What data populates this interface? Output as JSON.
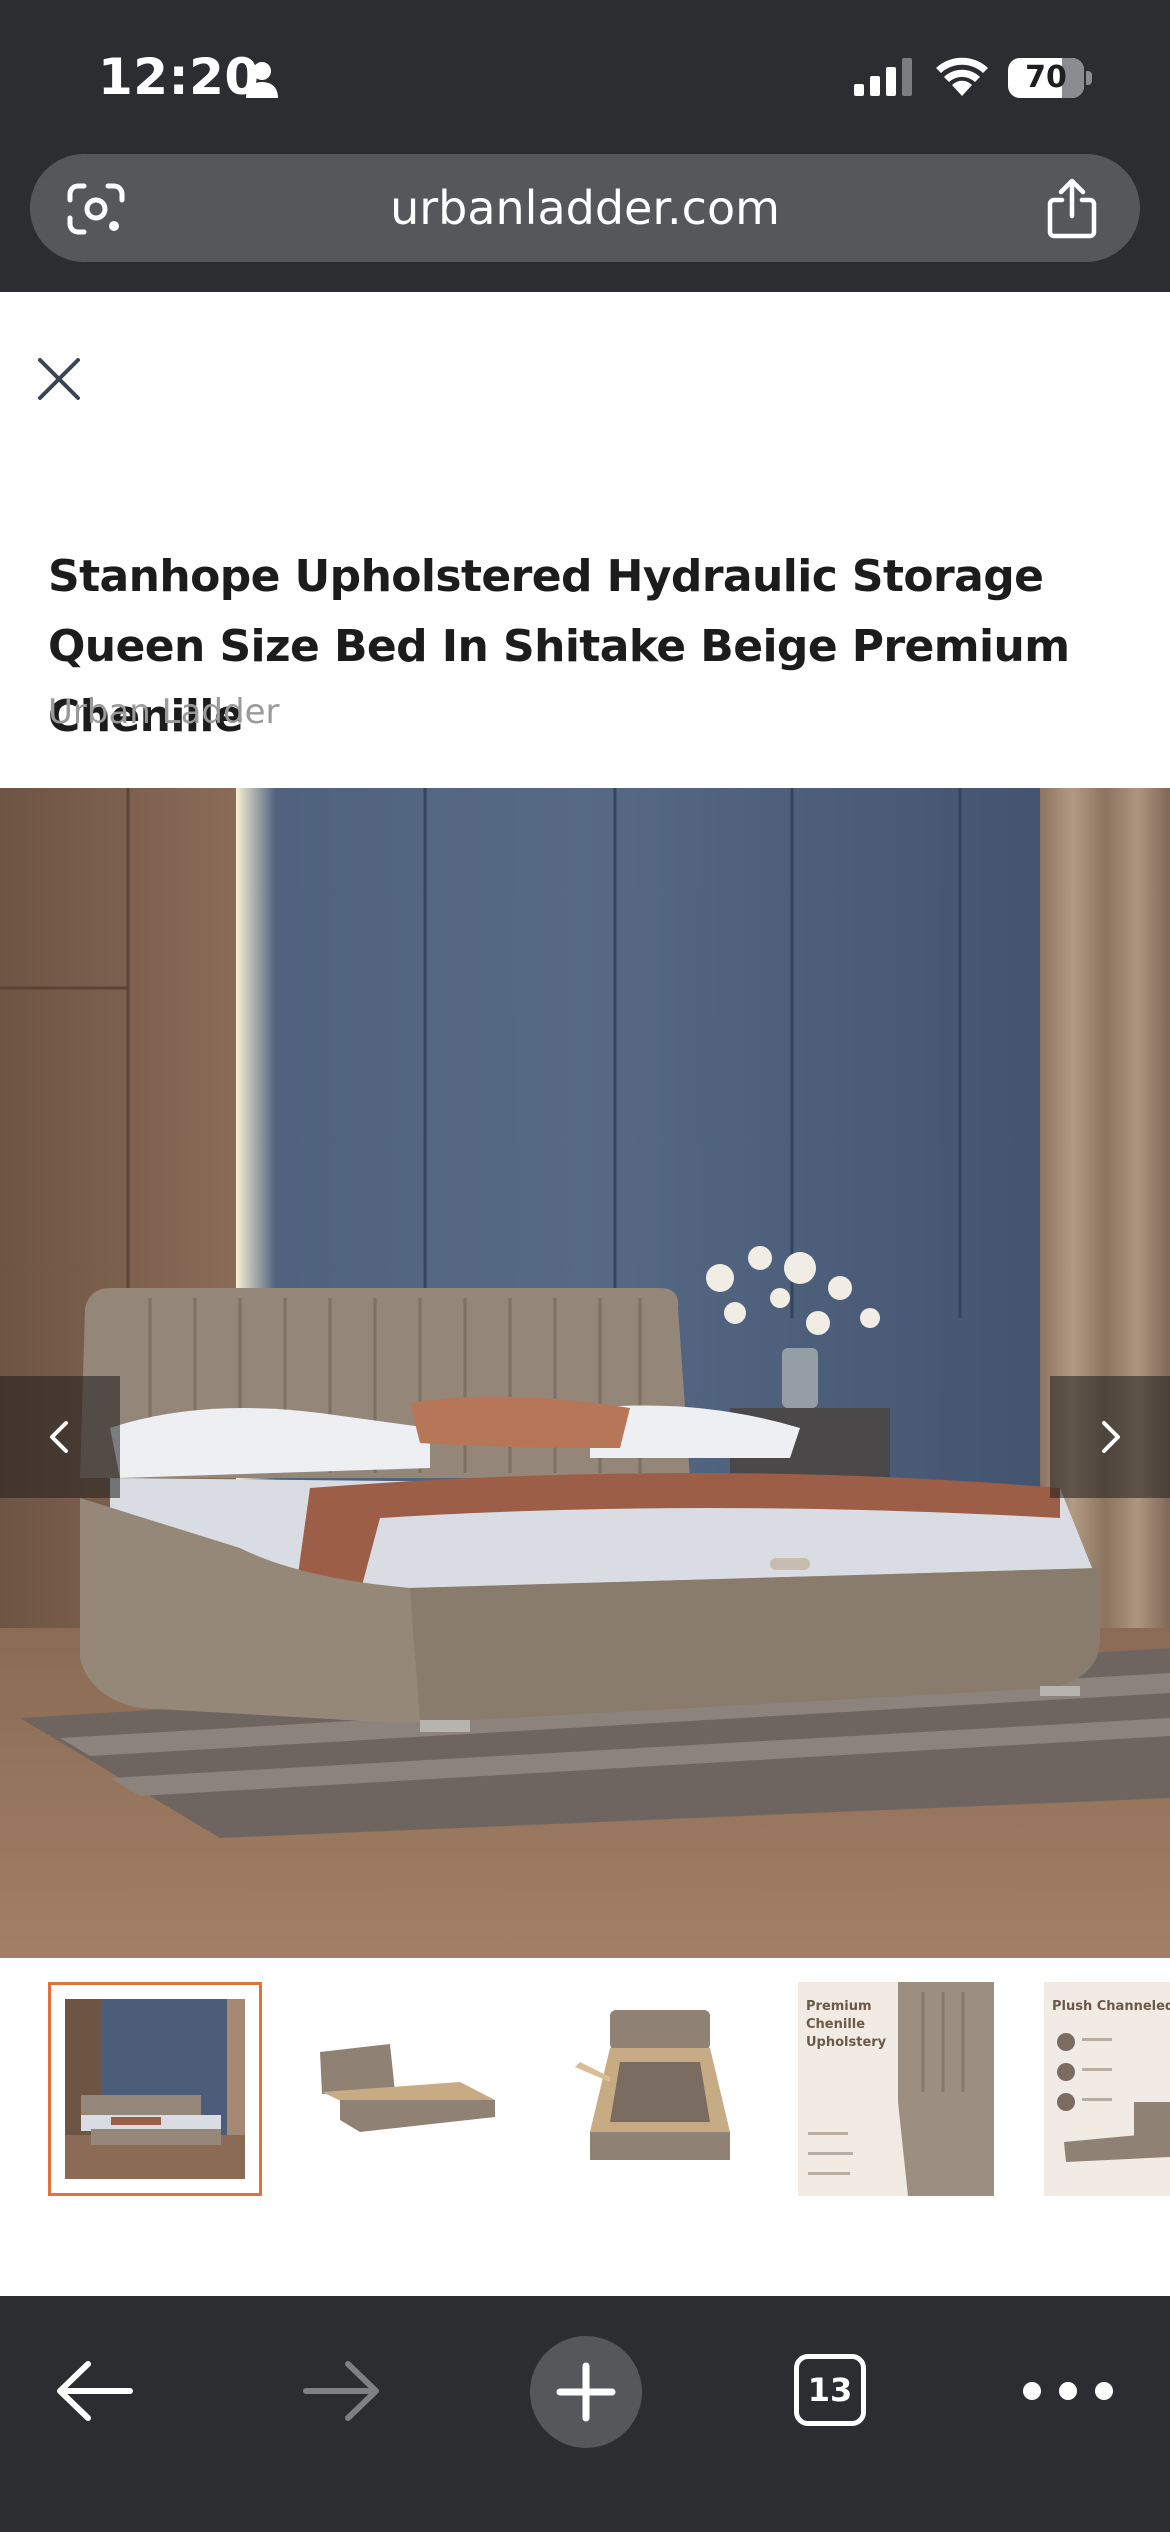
{
  "status_bar": {
    "time": "12:20",
    "battery": "70"
  },
  "browser": {
    "url": "urbanladder.com",
    "tab_count": "13"
  },
  "product": {
    "title": "Stanhope Upholstered Hydraulic Storage Queen Size Bed In Shitake Beige Premium Chenille",
    "brand": "Urban Ladder"
  },
  "gallery": {
    "selected_index": 0,
    "thumbnails": [
      {
        "alt": "bed-in-room-thumbnail"
      },
      {
        "alt": "bed-side-view-thumbnail"
      },
      {
        "alt": "bed-storage-open-thumbnail"
      },
      {
        "alt": "premium-chenille-upholstery-thumbnail",
        "text_lines": [
          "Premium",
          "Chenille",
          "Upholstery"
        ]
      },
      {
        "alt": "plush-channeled-headboard-thumbnail",
        "text_lines": [
          "Plush Channeled Headbo"
        ]
      }
    ]
  },
  "colors": {
    "chrome_bg": "#2c2d30",
    "pill_bg": "#55575b",
    "accent": "#e0733b"
  }
}
